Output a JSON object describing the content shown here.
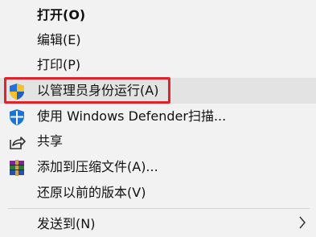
{
  "context_menu": {
    "items": [
      {
        "label": "打开(O)",
        "icon": null,
        "bold": true
      },
      {
        "label": "编辑(E)",
        "icon": null
      },
      {
        "label": "打印(P)",
        "icon": null
      },
      {
        "label": "以管理员身份运行(A)",
        "icon": "uac-shield-icon",
        "highlighted": true
      },
      {
        "label": "使用 Windows Defender扫描...",
        "icon": "defender-shield-icon"
      },
      {
        "label": "共享",
        "icon": "share-icon"
      },
      {
        "label": "添加到压缩文件(A)...",
        "icon": "winrar-icon"
      },
      {
        "label": "还原以前的版本(V)",
        "icon": null
      },
      {
        "label": "发送到(N)",
        "icon": null,
        "submenu": true
      }
    ],
    "highlight_color": "#e3e3e3",
    "annotation_color": "#e0232b"
  }
}
